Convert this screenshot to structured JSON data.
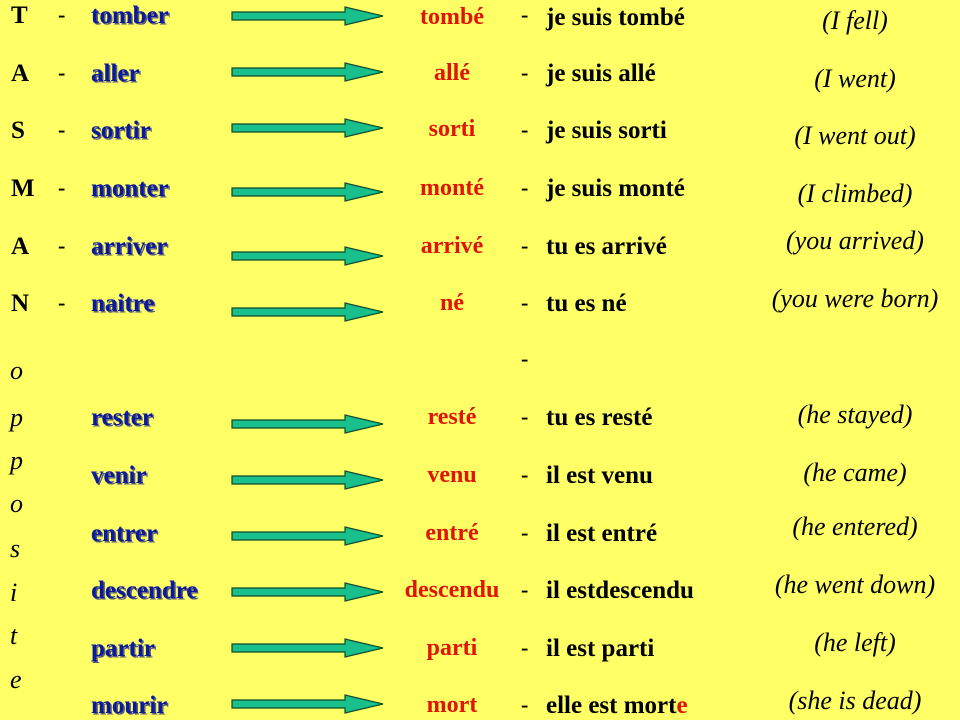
{
  "colors": {
    "background": "#ffff66",
    "verb": "#0a1a9a",
    "participle": "#e01400",
    "arrow_fill": "#19c08c",
    "arrow_stroke": "#0b4a2a",
    "text": "#000000"
  },
  "mnemonic_letters": [
    "T",
    "A",
    "S",
    "M",
    "A",
    "N"
  ],
  "opposite_letters": [
    "o",
    "p",
    "p",
    "o",
    "s",
    "i",
    "t",
    "e"
  ],
  "separator": "-",
  "arrow_icon": "right-arrow-icon",
  "rows": [
    {
      "verb": "tomber",
      "participle": "tombé",
      "phrase": "je suis tombé",
      "phrase_suffix": "",
      "english": "(I fell)"
    },
    {
      "verb": "aller",
      "participle": "allé",
      "phrase": "je suis allé",
      "phrase_suffix": "",
      "english": "(I went)"
    },
    {
      "verb": "sortir",
      "participle": "sorti",
      "phrase": "je suis sorti",
      "phrase_suffix": "",
      "english": "(I went out)"
    },
    {
      "verb": "monter",
      "participle": "monté",
      "phrase": "je suis monté",
      "phrase_suffix": "",
      "english": "(I climbed)"
    },
    {
      "verb": "arriver",
      "participle": "arrivé",
      "phrase": "tu es arrivé",
      "phrase_suffix": "",
      "english": "(you arrived)"
    },
    {
      "verb": "naitre",
      "participle": "né",
      "phrase": "tu es né",
      "phrase_suffix": "",
      "english": "(you were born)"
    },
    {
      "verb": "rester",
      "participle": "resté",
      "phrase": "tu es resté",
      "phrase_suffix": "",
      "english": "(he stayed)"
    },
    {
      "verb": "venir",
      "participle": "venu",
      "phrase": "il est venu",
      "phrase_suffix": "",
      "english": "(he came)"
    },
    {
      "verb": "entrer",
      "participle": "entré",
      "phrase": "il est entré",
      "phrase_suffix": "",
      "english": "(he entered)"
    },
    {
      "verb": "descendre",
      "participle": "descendu",
      "phrase": "il estdescendu",
      "phrase_suffix": "",
      "english": "(he went down)"
    },
    {
      "verb": "partir",
      "participle": "parti",
      "phrase": "il est parti",
      "phrase_suffix": "",
      "english": "(he left)"
    },
    {
      "verb": "mourir",
      "participle": "mort",
      "phrase": "elle est mort",
      "phrase_suffix": "e",
      "english": "(she is dead)"
    }
  ]
}
